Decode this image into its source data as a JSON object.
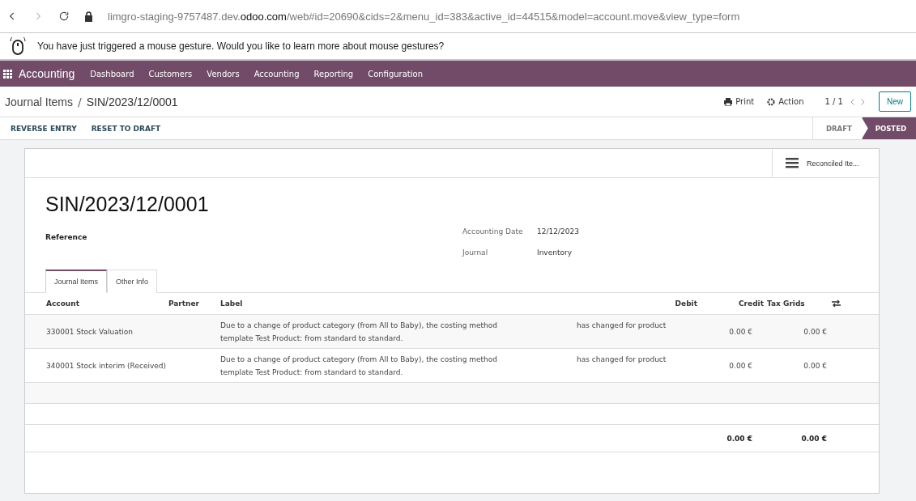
{
  "browser": {
    "url_host_prefix": "limgro-staging-9757487.dev.",
    "url_host_domain": "odoo.com",
    "url_path": "/web#id=20690&cids=2&menu_id=383&active_id=44515&model=account.move&view_type=form"
  },
  "notification": {
    "text": "You have just triggered a mouse gesture. Would you like to learn more about mouse gestures?"
  },
  "navbar": {
    "app": "Accounting",
    "menus": [
      "Dashboard",
      "Customers",
      "Vendors",
      "Accounting",
      "Reporting",
      "Configuration"
    ]
  },
  "breadcrumb": {
    "parent": "Journal Items",
    "separator": "/",
    "current": "SIN/2023/12/0001"
  },
  "control_panel": {
    "print": "Print",
    "action": "Action",
    "pager": "1 / 1",
    "new": "New"
  },
  "header_buttons": [
    "REVERSE ENTRY",
    "RESET TO DRAFT"
  ],
  "statusbar": [
    {
      "label": "DRAFT",
      "selected": false
    },
    {
      "label": "POSTED",
      "selected": true
    }
  ],
  "smart_button": {
    "label": "Reconciled Ite..."
  },
  "form": {
    "title": "SIN/2023/12/0001",
    "reference_label": "Reference",
    "fields": [
      {
        "label": "Accounting Date",
        "value": "12/12/2023"
      },
      {
        "label": "Journal",
        "value": "Inventory"
      }
    ]
  },
  "tabs": [
    {
      "label": "Journal Items",
      "selected": true
    },
    {
      "label": "Other Info",
      "selected": false
    }
  ],
  "table": {
    "columns": [
      "Account",
      "Partner",
      "Label",
      "Debit",
      "Credit",
      "Tax Grids"
    ],
    "rows": [
      {
        "account": "330001 Stock Valuation",
        "label": {
          "first_line": "Due to a change of product category (from All to Baby), the costing method",
          "gap_text": "has changed for product",
          "second_line": "template Test Product: from standard to standard."
        },
        "debit": "0.00 €",
        "credit": "0.00 €"
      },
      {
        "account": "340001 Stock interim (Received)",
        "label": {
          "first_line": "Due to a change of product category (from All to Baby), the costing method",
          "gap_text": "has changed for product",
          "second_line": "template Test Product: from standard to standard."
        },
        "debit": "0.00 €",
        "credit": "0.00 €"
      }
    ],
    "totals": {
      "debit": "0.00 €",
      "credit": "0.00 €"
    }
  }
}
